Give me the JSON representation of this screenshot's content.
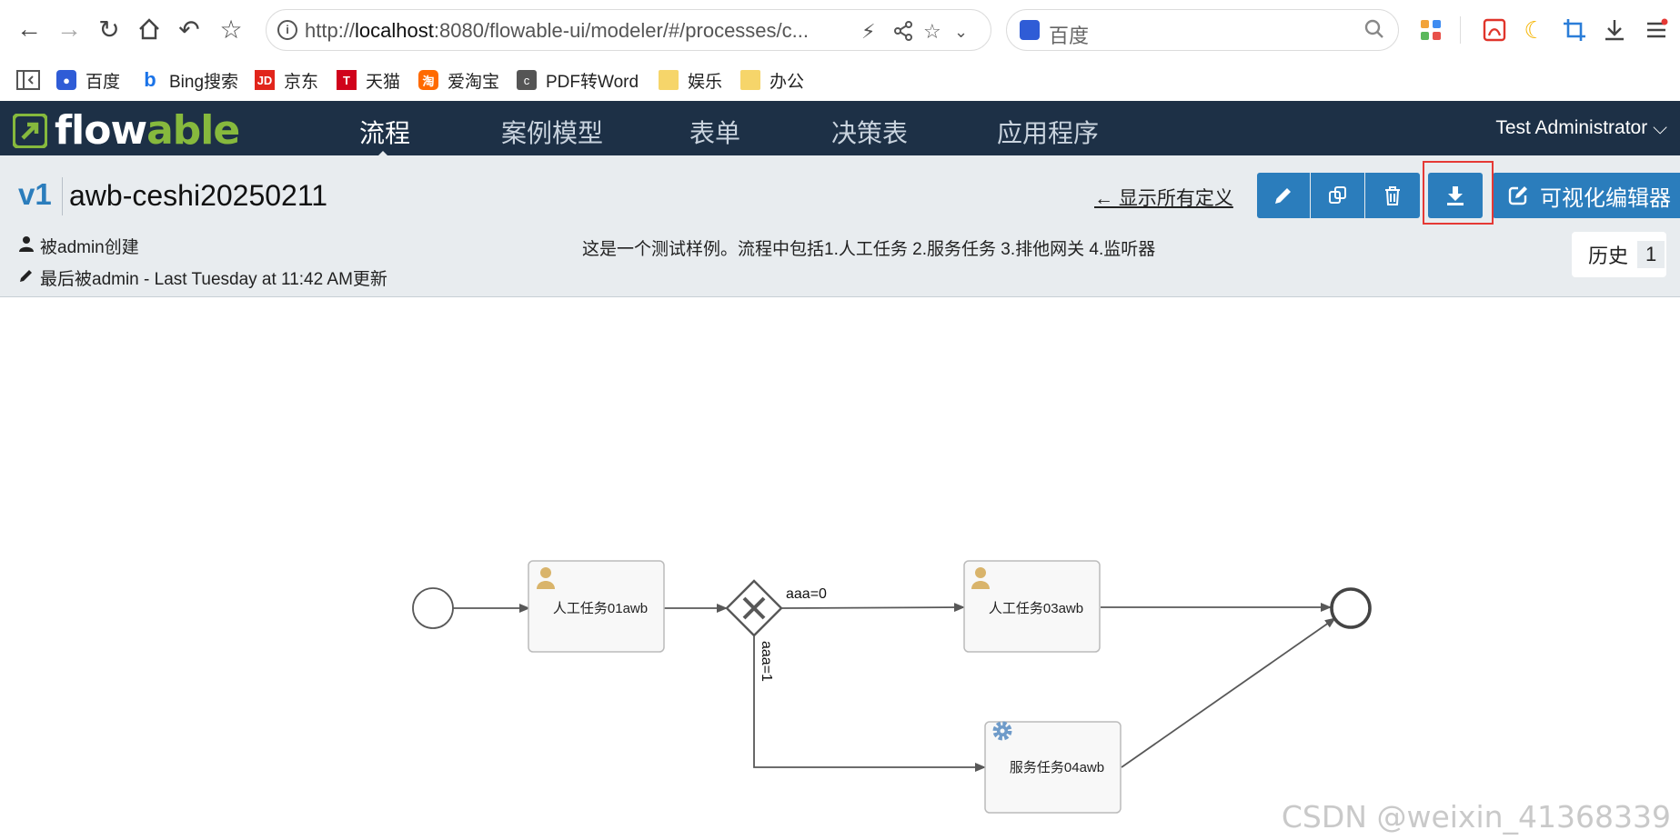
{
  "browser": {
    "url_host": "localhost",
    "url_prefix": "http://",
    "url_rest": ":8080/flowable-ui/modeler/#/processes/c...",
    "search_placeholder": "百度",
    "bookmarks": [
      {
        "label": "百度",
        "icon": "baidu-paw-icon"
      },
      {
        "label": "Bing搜索",
        "icon": "bing-icon"
      },
      {
        "label": "京东",
        "icon": "jd-icon",
        "badge": "JD"
      },
      {
        "label": "天猫",
        "icon": "tmall-icon",
        "badge": "T"
      },
      {
        "label": "爱淘宝",
        "icon": "taobao-icon",
        "badge": "淘"
      },
      {
        "label": "PDF转Word",
        "icon": "pdf-convert-icon",
        "badge": "c"
      },
      {
        "label": "娱乐",
        "icon": "folder-icon"
      },
      {
        "label": "办公",
        "icon": "folder-icon"
      }
    ]
  },
  "app": {
    "logo": {
      "part1": "flow",
      "part2": "able"
    },
    "menu": [
      {
        "label": "流程",
        "active": true
      },
      {
        "label": "案例模型",
        "active": false
      },
      {
        "label": "表单",
        "active": false
      },
      {
        "label": "决策表",
        "active": false
      },
      {
        "label": "应用程序",
        "active": false
      }
    ],
    "user": "Test Administrator"
  },
  "definition": {
    "version": "v1",
    "name": "awb-ceshi20250211",
    "created_by": "被admin创建",
    "updated_by": "最后被admin - Last Tuesday at 11:42 AM更新",
    "description": "这是一个测试样例。流程中包括1.人工任务 2.服务任务 3.排他网关 4.监听器",
    "show_all": "← 显示所有定义",
    "visual_editor": "可视化编辑器",
    "history_label": "历史",
    "history_count": "1"
  },
  "diagram": {
    "task1": "人工任务01awb",
    "task3": "人工任务03awb",
    "task4": "服务任务04awb",
    "cond_top": "aaa=0",
    "cond_down": "aaa=1"
  },
  "watermark": "CSDN @weixin_41368339",
  "colors": {
    "header_bg": "#1d3046",
    "accent_blue": "#2b7dbc",
    "logo_green": "#86b93d",
    "highlight_red": "#e53935"
  }
}
